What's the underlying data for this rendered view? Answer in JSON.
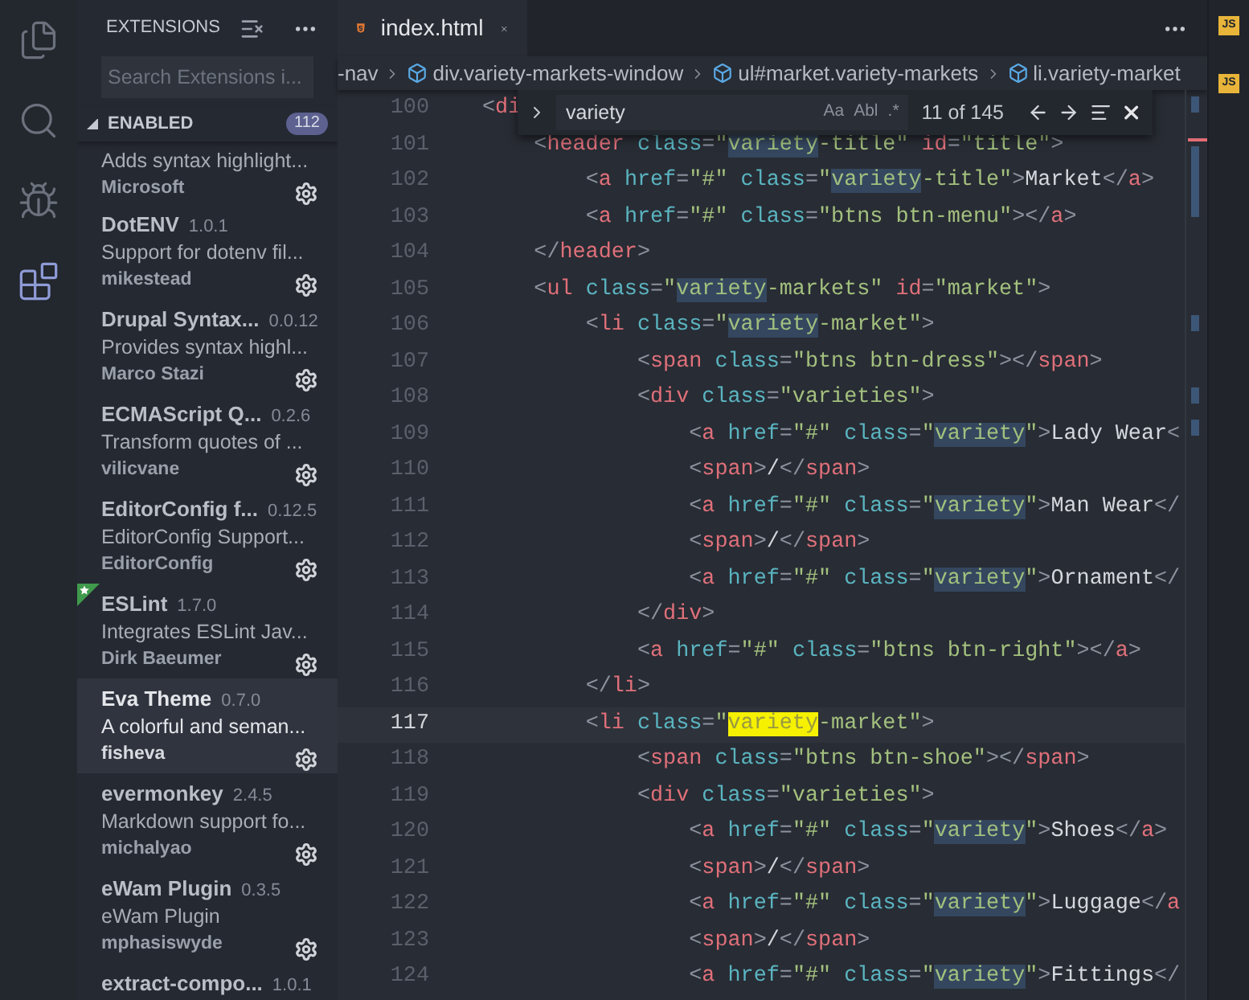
{
  "activity_bar": {
    "items": [
      {
        "kind": "files",
        "selected": false
      },
      {
        "kind": "search",
        "selected": false
      },
      {
        "kind": "debug",
        "selected": false
      },
      {
        "kind": "extensions",
        "selected": true
      }
    ]
  },
  "sidebar": {
    "title": "EXTENSIONS",
    "search": {
      "placeholder": "Search Extensions i..."
    },
    "section": {
      "label": "ENABLED",
      "count": "112",
      "expanded": true
    },
    "extensions": [
      {
        "description": "Adds syntax highlight...",
        "publisher": "Microsoft",
        "selected": false,
        "starred": false
      },
      {
        "name": "DotENV",
        "version": "1.0.1",
        "description": "Support for dotenv fil...",
        "publisher": "mikestead",
        "selected": false,
        "starred": false
      },
      {
        "name": "Drupal Syntax...",
        "version": "0.0.12",
        "description": "Provides syntax highl...",
        "publisher": "Marco Stazi",
        "selected": false,
        "starred": false
      },
      {
        "name": "ECMAScript Q...",
        "version": "0.2.6",
        "description": "Transform quotes of ...",
        "publisher": "vilicvane",
        "selected": false,
        "starred": false
      },
      {
        "name": "EditorConfig f...",
        "version": "0.12.5",
        "description": "EditorConfig Support...",
        "publisher": "EditorConfig",
        "selected": false,
        "starred": false
      },
      {
        "name": "ESLint",
        "version": "1.7.0",
        "description": "Integrates ESLint Jav...",
        "publisher": "Dirk Baeumer",
        "selected": false,
        "starred": true
      },
      {
        "name": "Eva Theme",
        "version": "0.7.0",
        "description": "A colorful and seman...",
        "publisher": "fisheva",
        "selected": true,
        "starred": false
      },
      {
        "name": "evermonkey",
        "version": "2.4.5",
        "description": "Markdown support fo...",
        "publisher": "michalyao",
        "selected": false,
        "starred": false
      },
      {
        "name": "eWam Plugin",
        "version": "0.3.5",
        "description": "eWam Plugin",
        "publisher": "mphasiswyde",
        "selected": false,
        "starred": false
      },
      {
        "name": "extract-compo...",
        "version": "1.0.1"
      }
    ]
  },
  "editor": {
    "tabs": [
      {
        "label": "index.html",
        "selected": true
      }
    ],
    "breadcrumbs": [
      "-nav",
      "div.variety-markets-window",
      "ul#market.variety-markets",
      "li.variety-market"
    ],
    "find_widget": {
      "value": "variety",
      "options": [
        "Aa",
        "Abl",
        ".*"
      ],
      "count": "11 of 145"
    },
    "lines": [
      {
        "number": "100",
        "current": false,
        "segments": [
          {
            "kind": "punct",
            "text": "<"
          },
          {
            "kind": "tag",
            "text": "di"
          }
        ],
        "children": [
          {
            "number": "101",
            "current": false,
            "segments": [
              {
                "kind": "punct",
                "text": "<"
              },
              {
                "kind": "tag",
                "text": "header"
              },
              {
                "kind": "attr",
                "text": " class"
              },
              {
                "kind": "punct",
                "text": "="
              },
              {
                "kind": "string",
                "text": "\""
              },
              {
                "kind": "match",
                "text": "variety"
              },
              {
                "kind": "string",
                "text": "-title\""
              },
              {
                "kind": "id",
                "text": " id"
              },
              {
                "kind": "punct",
                "text": "="
              },
              {
                "kind": "string",
                "text": "\"title\""
              },
              {
                "kind": "punct",
                "text": ">"
              }
            ],
            "children": [
              {
                "number": "102",
                "current": false,
                "segments": [
                  {
                    "kind": "punct",
                    "text": "<"
                  },
                  {
                    "kind": "tag",
                    "text": "a"
                  },
                  {
                    "kind": "attr",
                    "text": " href"
                  },
                  {
                    "kind": "punct",
                    "text": "="
                  },
                  {
                    "kind": "string",
                    "text": "\"#\""
                  },
                  {
                    "kind": "attr",
                    "text": " class"
                  },
                  {
                    "kind": "punct",
                    "text": "="
                  },
                  {
                    "kind": "string",
                    "text": "\""
                  },
                  {
                    "kind": "match",
                    "text": "variety"
                  },
                  {
                    "kind": "string",
                    "text": "-title\""
                  },
                  {
                    "kind": "punct",
                    "text": ">"
                  },
                  {
                    "kind": "text",
                    "text": "Market"
                  },
                  {
                    "kind": "punct",
                    "text": "</"
                  },
                  {
                    "kind": "tag",
                    "text": "a"
                  },
                  {
                    "kind": "punct",
                    "text": ">"
                  }
                ]
              },
              {
                "number": "103",
                "current": false,
                "segments": [
                  {
                    "kind": "punct",
                    "text": "<"
                  },
                  {
                    "kind": "tag",
                    "text": "a"
                  },
                  {
                    "kind": "attr",
                    "text": " href"
                  },
                  {
                    "kind": "punct",
                    "text": "="
                  },
                  {
                    "kind": "string",
                    "text": "\"#\""
                  },
                  {
                    "kind": "attr",
                    "text": " class"
                  },
                  {
                    "kind": "punct",
                    "text": "="
                  },
                  {
                    "kind": "string",
                    "text": "\"btns btn-menu\""
                  },
                  {
                    "kind": "punct",
                    "text": "></"
                  },
                  {
                    "kind": "tag",
                    "text": "a"
                  },
                  {
                    "kind": "punct",
                    "text": ">"
                  }
                ]
              }
            ]
          },
          {
            "number": "104",
            "current": false,
            "segments": [
              {
                "kind": "punct",
                "text": "</"
              },
              {
                "kind": "tag",
                "text": "header"
              },
              {
                "kind": "punct",
                "text": ">"
              }
            ]
          },
          {
            "number": "105",
            "current": false,
            "segments": [
              {
                "kind": "punct",
                "text": "<"
              },
              {
                "kind": "tag",
                "text": "ul"
              },
              {
                "kind": "attr",
                "text": " class"
              },
              {
                "kind": "punct",
                "text": "="
              },
              {
                "kind": "string",
                "text": "\""
              },
              {
                "kind": "match",
                "text": "variety"
              },
              {
                "kind": "string",
                "text": "-markets\""
              },
              {
                "kind": "id",
                "text": " id"
              },
              {
                "kind": "punct",
                "text": "="
              },
              {
                "kind": "string",
                "text": "\"market\""
              },
              {
                "kind": "punct",
                "text": ">"
              }
            ],
            "children": [
              {
                "number": "106",
                "current": false,
                "segments": [
                  {
                    "kind": "punct",
                    "text": "<"
                  },
                  {
                    "kind": "tag",
                    "text": "li"
                  },
                  {
                    "kind": "attr",
                    "text": " class"
                  },
                  {
                    "kind": "punct",
                    "text": "="
                  },
                  {
                    "kind": "string",
                    "text": "\""
                  },
                  {
                    "kind": "match",
                    "text": "variety"
                  },
                  {
                    "kind": "string",
                    "text": "-market\""
                  },
                  {
                    "kind": "punct",
                    "text": ">"
                  }
                ],
                "children": [
                  {
                    "number": "107",
                    "current": false,
                    "segments": [
                      {
                        "kind": "punct",
                        "text": "<"
                      },
                      {
                        "kind": "tag",
                        "text": "span"
                      },
                      {
                        "kind": "attr",
                        "text": " class"
                      },
                      {
                        "kind": "punct",
                        "text": "="
                      },
                      {
                        "kind": "string",
                        "text": "\"btns btn-dress\""
                      },
                      {
                        "kind": "punct",
                        "text": "></"
                      },
                      {
                        "kind": "tag",
                        "text": "span"
                      },
                      {
                        "kind": "punct",
                        "text": ">"
                      }
                    ]
                  },
                  {
                    "number": "108",
                    "current": false,
                    "segments": [
                      {
                        "kind": "punct",
                        "text": "<"
                      },
                      {
                        "kind": "tag",
                        "text": "div"
                      },
                      {
                        "kind": "attr",
                        "text": " class"
                      },
                      {
                        "kind": "punct",
                        "text": "="
                      },
                      {
                        "kind": "string",
                        "text": "\"varieties\""
                      },
                      {
                        "kind": "punct",
                        "text": ">"
                      }
                    ],
                    "children": [
                      {
                        "number": "109",
                        "current": false,
                        "segments": [
                          {
                            "kind": "punct",
                            "text": "<"
                          },
                          {
                            "kind": "tag",
                            "text": "a"
                          },
                          {
                            "kind": "attr",
                            "text": " href"
                          },
                          {
                            "kind": "punct",
                            "text": "="
                          },
                          {
                            "kind": "string",
                            "text": "\"#\""
                          },
                          {
                            "kind": "attr",
                            "text": " class"
                          },
                          {
                            "kind": "punct",
                            "text": "="
                          },
                          {
                            "kind": "string",
                            "text": "\""
                          },
                          {
                            "kind": "match",
                            "text": "variety"
                          },
                          {
                            "kind": "string",
                            "text": "\""
                          },
                          {
                            "kind": "punct",
                            "text": ">"
                          },
                          {
                            "kind": "text",
                            "text": "Lady Wear"
                          },
                          {
                            "kind": "punct",
                            "text": "<"
                          }
                        ]
                      },
                      {
                        "number": "110",
                        "current": false,
                        "segments": [
                          {
                            "kind": "punct",
                            "text": "<"
                          },
                          {
                            "kind": "tag",
                            "text": "span"
                          },
                          {
                            "kind": "punct",
                            "text": ">"
                          },
                          {
                            "kind": "text",
                            "text": "/"
                          },
                          {
                            "kind": "punct",
                            "text": "</"
                          },
                          {
                            "kind": "tag",
                            "text": "span"
                          },
                          {
                            "kind": "punct",
                            "text": ">"
                          }
                        ]
                      },
                      {
                        "number": "111",
                        "current": false,
                        "segments": [
                          {
                            "kind": "punct",
                            "text": "<"
                          },
                          {
                            "kind": "tag",
                            "text": "a"
                          },
                          {
                            "kind": "attr",
                            "text": " href"
                          },
                          {
                            "kind": "punct",
                            "text": "="
                          },
                          {
                            "kind": "string",
                            "text": "\"#\""
                          },
                          {
                            "kind": "attr",
                            "text": " class"
                          },
                          {
                            "kind": "punct",
                            "text": "="
                          },
                          {
                            "kind": "string",
                            "text": "\""
                          },
                          {
                            "kind": "match",
                            "text": "variety"
                          },
                          {
                            "kind": "string",
                            "text": "\""
                          },
                          {
                            "kind": "punct",
                            "text": ">"
                          },
                          {
                            "kind": "text",
                            "text": "Man Wear"
                          },
                          {
                            "kind": "punct",
                            "text": "</"
                          }
                        ]
                      },
                      {
                        "number": "112",
                        "current": false,
                        "segments": [
                          {
                            "kind": "punct",
                            "text": "<"
                          },
                          {
                            "kind": "tag",
                            "text": "span"
                          },
                          {
                            "kind": "punct",
                            "text": ">"
                          },
                          {
                            "kind": "text",
                            "text": "/"
                          },
                          {
                            "kind": "punct",
                            "text": "</"
                          },
                          {
                            "kind": "tag",
                            "text": "span"
                          },
                          {
                            "kind": "punct",
                            "text": ">"
                          }
                        ]
                      },
                      {
                        "number": "113",
                        "current": false,
                        "segments": [
                          {
                            "kind": "punct",
                            "text": "<"
                          },
                          {
                            "kind": "tag",
                            "text": "a"
                          },
                          {
                            "kind": "attr",
                            "text": " href"
                          },
                          {
                            "kind": "punct",
                            "text": "="
                          },
                          {
                            "kind": "string",
                            "text": "\"#\""
                          },
                          {
                            "kind": "attr",
                            "text": " class"
                          },
                          {
                            "kind": "punct",
                            "text": "="
                          },
                          {
                            "kind": "string",
                            "text": "\""
                          },
                          {
                            "kind": "match",
                            "text": "variety"
                          },
                          {
                            "kind": "string",
                            "text": "\""
                          },
                          {
                            "kind": "punct",
                            "text": ">"
                          },
                          {
                            "kind": "text",
                            "text": "Ornament"
                          },
                          {
                            "kind": "punct",
                            "text": "</"
                          }
                        ]
                      }
                    ]
                  },
                  {
                    "number": "114",
                    "current": false,
                    "segments": [
                      {
                        "kind": "punct",
                        "text": "</"
                      },
                      {
                        "kind": "tag",
                        "text": "div"
                      },
                      {
                        "kind": "punct",
                        "text": ">"
                      }
                    ]
                  },
                  {
                    "number": "115",
                    "current": false,
                    "segments": [
                      {
                        "kind": "punct",
                        "text": "<"
                      },
                      {
                        "kind": "tag",
                        "text": "a"
                      },
                      {
                        "kind": "attr",
                        "text": " href"
                      },
                      {
                        "kind": "punct",
                        "text": "="
                      },
                      {
                        "kind": "string",
                        "text": "\"#\""
                      },
                      {
                        "kind": "attr",
                        "text": " class"
                      },
                      {
                        "kind": "punct",
                        "text": "="
                      },
                      {
                        "kind": "string",
                        "text": "\"btns btn-right\""
                      },
                      {
                        "kind": "punct",
                        "text": "></"
                      },
                      {
                        "kind": "tag",
                        "text": "a"
                      },
                      {
                        "kind": "punct",
                        "text": ">"
                      }
                    ]
                  }
                ]
              },
              {
                "number": "116",
                "current": false,
                "segments": [
                  {
                    "kind": "punct",
                    "text": "</"
                  },
                  {
                    "kind": "tag",
                    "text": "li"
                  },
                  {
                    "kind": "punct",
                    "text": ">"
                  }
                ]
              },
              {
                "number": "117",
                "current": true,
                "segments": [
                  {
                    "kind": "punct",
                    "text": "<"
                  },
                  {
                    "kind": "tag",
                    "text": "li"
                  },
                  {
                    "kind": "attr",
                    "text": " class"
                  },
                  {
                    "kind": "punct",
                    "text": "="
                  },
                  {
                    "kind": "string",
                    "text": "\""
                  },
                  {
                    "kind": "current_match",
                    "text": "variety"
                  },
                  {
                    "kind": "string",
                    "text": "-market\""
                  },
                  {
                    "kind": "punct",
                    "text": ">"
                  }
                ],
                "children": [
                  {
                    "number": "118",
                    "current": false,
                    "segments": [
                      {
                        "kind": "punct",
                        "text": "<"
                      },
                      {
                        "kind": "tag",
                        "text": "span"
                      },
                      {
                        "kind": "attr",
                        "text": " class"
                      },
                      {
                        "kind": "punct",
                        "text": "="
                      },
                      {
                        "kind": "string",
                        "text": "\"btns btn-shoe\""
                      },
                      {
                        "kind": "punct",
                        "text": "></"
                      },
                      {
                        "kind": "tag",
                        "text": "span"
                      },
                      {
                        "kind": "punct",
                        "text": ">"
                      }
                    ]
                  },
                  {
                    "number": "119",
                    "current": false,
                    "segments": [
                      {
                        "kind": "punct",
                        "text": "<"
                      },
                      {
                        "kind": "tag",
                        "text": "div"
                      },
                      {
                        "kind": "attr",
                        "text": " class"
                      },
                      {
                        "kind": "punct",
                        "text": "="
                      },
                      {
                        "kind": "string",
                        "text": "\"varieties\""
                      },
                      {
                        "kind": "punct",
                        "text": ">"
                      }
                    ],
                    "children": [
                      {
                        "number": "120",
                        "current": false,
                        "segments": [
                          {
                            "kind": "punct",
                            "text": "<"
                          },
                          {
                            "kind": "tag",
                            "text": "a"
                          },
                          {
                            "kind": "attr",
                            "text": " href"
                          },
                          {
                            "kind": "punct",
                            "text": "="
                          },
                          {
                            "kind": "string",
                            "text": "\"#\""
                          },
                          {
                            "kind": "attr",
                            "text": " class"
                          },
                          {
                            "kind": "punct",
                            "text": "="
                          },
                          {
                            "kind": "string",
                            "text": "\""
                          },
                          {
                            "kind": "match",
                            "text": "variety"
                          },
                          {
                            "kind": "string",
                            "text": "\""
                          },
                          {
                            "kind": "punct",
                            "text": ">"
                          },
                          {
                            "kind": "text",
                            "text": "Shoes"
                          },
                          {
                            "kind": "punct",
                            "text": "</"
                          },
                          {
                            "kind": "tag",
                            "text": "a"
                          },
                          {
                            "kind": "punct",
                            "text": ">"
                          }
                        ]
                      },
                      {
                        "number": "121",
                        "current": false,
                        "segments": [
                          {
                            "kind": "punct",
                            "text": "<"
                          },
                          {
                            "kind": "tag",
                            "text": "span"
                          },
                          {
                            "kind": "punct",
                            "text": ">"
                          },
                          {
                            "kind": "text",
                            "text": "/"
                          },
                          {
                            "kind": "punct",
                            "text": "</"
                          },
                          {
                            "kind": "tag",
                            "text": "span"
                          },
                          {
                            "kind": "punct",
                            "text": ">"
                          }
                        ]
                      },
                      {
                        "number": "122",
                        "current": false,
                        "segments": [
                          {
                            "kind": "punct",
                            "text": "<"
                          },
                          {
                            "kind": "tag",
                            "text": "a"
                          },
                          {
                            "kind": "attr",
                            "text": " href"
                          },
                          {
                            "kind": "punct",
                            "text": "="
                          },
                          {
                            "kind": "string",
                            "text": "\"#\""
                          },
                          {
                            "kind": "attr",
                            "text": " class"
                          },
                          {
                            "kind": "punct",
                            "text": "="
                          },
                          {
                            "kind": "string",
                            "text": "\""
                          },
                          {
                            "kind": "match",
                            "text": "variety"
                          },
                          {
                            "kind": "string",
                            "text": "\""
                          },
                          {
                            "kind": "punct",
                            "text": ">"
                          },
                          {
                            "kind": "text",
                            "text": "Luggage"
                          },
                          {
                            "kind": "punct",
                            "text": "</"
                          },
                          {
                            "kind": "tag",
                            "text": "a"
                          }
                        ]
                      },
                      {
                        "number": "123",
                        "current": false,
                        "segments": [
                          {
                            "kind": "punct",
                            "text": "<"
                          },
                          {
                            "kind": "tag",
                            "text": "span"
                          },
                          {
                            "kind": "punct",
                            "text": ">"
                          },
                          {
                            "kind": "text",
                            "text": "/"
                          },
                          {
                            "kind": "punct",
                            "text": "</"
                          },
                          {
                            "kind": "tag",
                            "text": "span"
                          },
                          {
                            "kind": "punct",
                            "text": ">"
                          }
                        ]
                      },
                      {
                        "number": "124",
                        "current": false,
                        "segments": [
                          {
                            "kind": "punct",
                            "text": "<"
                          },
                          {
                            "kind": "tag",
                            "text": "a"
                          },
                          {
                            "kind": "attr",
                            "text": " href"
                          },
                          {
                            "kind": "punct",
                            "text": "="
                          },
                          {
                            "kind": "string",
                            "text": "\"#\""
                          },
                          {
                            "kind": "attr",
                            "text": " class"
                          },
                          {
                            "kind": "punct",
                            "text": "="
                          },
                          {
                            "kind": "string",
                            "text": "\""
                          },
                          {
                            "kind": "match",
                            "text": "variety"
                          },
                          {
                            "kind": "string",
                            "text": "\""
                          },
                          {
                            "kind": "punct",
                            "text": ">"
                          },
                          {
                            "kind": "text",
                            "text": "Fittings"
                          },
                          {
                            "kind": "punct",
                            "text": "</"
                          }
                        ]
                      }
                    ]
                  }
                ]
              }
            ]
          }
        ]
      }
    ]
  },
  "side_group": {
    "tab_icon_label": "JS",
    "breadcrumb_icon_label": "JS"
  }
}
